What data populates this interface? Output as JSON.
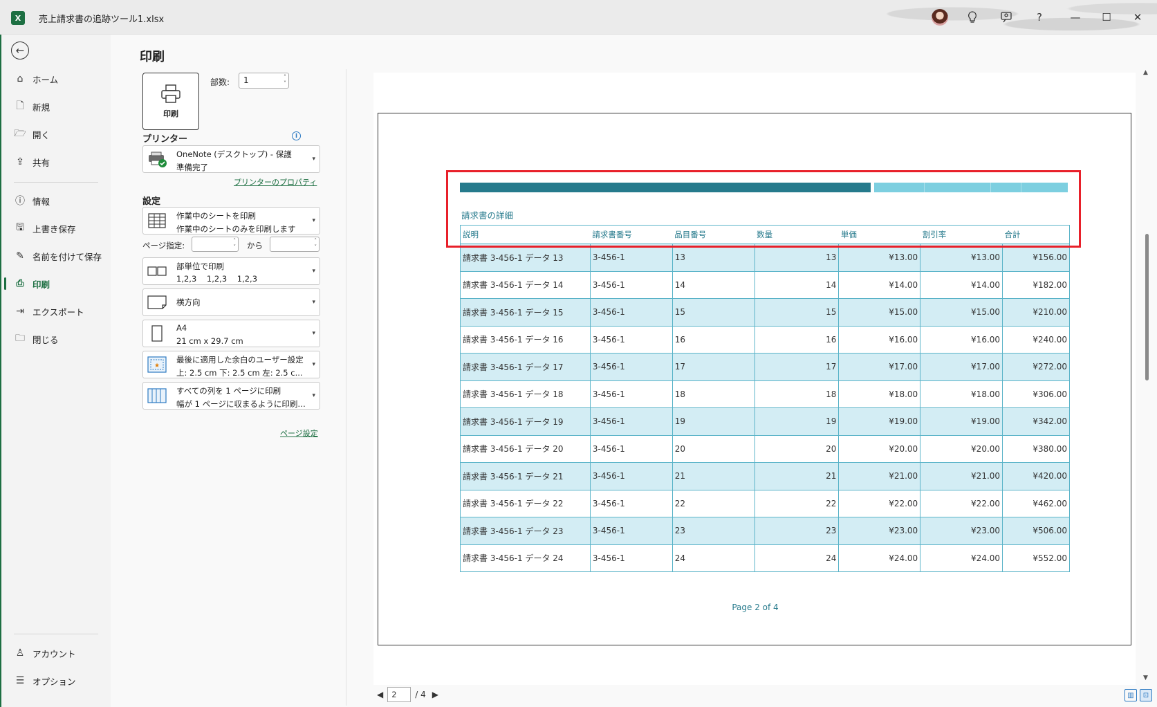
{
  "window": {
    "title": "売上請求書の追跡ツール1.xlsx",
    "app_icon_text": "X",
    "controls": [
      "avatar-icon",
      "lightbulb-icon",
      "coauthor-icon",
      "help-icon",
      "minimize-icon",
      "maximize-icon",
      "close-icon"
    ],
    "help_glyph": "?",
    "min_glyph": "—",
    "max_glyph": "☐",
    "close_glyph": "✕"
  },
  "nav": {
    "back_glyph": "←",
    "items": [
      {
        "label": "ホーム",
        "icon": "home-icon",
        "glyph": "⌂"
      },
      {
        "label": "新規",
        "icon": "new-document-icon",
        "glyph": "🗋"
      },
      {
        "label": "開く",
        "icon": "open-folder-icon",
        "glyph": "🗁"
      },
      {
        "label": "共有",
        "icon": "share-icon",
        "glyph": "⇪"
      },
      {
        "label": "情報",
        "icon": "info-icon",
        "glyph": "ⓘ"
      },
      {
        "label": "上書き保存",
        "icon": "save-icon",
        "glyph": "🖫"
      },
      {
        "label": "名前を付けて保存",
        "icon": "save-as-icon",
        "glyph": "✎"
      },
      {
        "label": "印刷",
        "icon": "print-icon",
        "glyph": "⎙"
      },
      {
        "label": "エクスポート",
        "icon": "export-icon",
        "glyph": "⇥"
      },
      {
        "label": "閉じる",
        "icon": "close-folder-icon",
        "glyph": "🗀"
      }
    ],
    "bottom_items": [
      {
        "label": "アカウント",
        "icon": "account-icon",
        "glyph": "♙"
      },
      {
        "label": "オプション",
        "icon": "options-icon",
        "glyph": "☰"
      }
    ]
  },
  "print": {
    "heading": "印刷",
    "print_button_label": "印刷",
    "copies_label": "部数:",
    "copies_value": "1",
    "printer_section": "プリンター",
    "printer_name": "OneNote (デスクトップ) - 保護",
    "printer_status": "準備完了",
    "printer_properties_link": "プリンターのプロパティ",
    "settings_section": "設定",
    "what_to_print": {
      "l1": "作業中のシートを印刷",
      "l2": "作業中のシートのみを印刷します"
    },
    "page_range_label": "ページ指定:",
    "page_range_to": "から",
    "collate": {
      "l1": "部単位で印刷",
      "l2": "1,2,3    1,2,3    1,2,3"
    },
    "orientation": "横方向",
    "paper": {
      "l1": "A4",
      "l2": "21 cm x 29.7 cm"
    },
    "margins": {
      "l1": "最後に適用した余白のユーザー設定",
      "l2": "上: 2.5 cm 下: 2.5 cm 左: 2.5 c..."
    },
    "scaling": {
      "l1": "すべての列を 1 ページに印刷",
      "l2": "幅が 1 ページに収まるように印刷イメ..."
    },
    "page_setup_link": "ページ設定"
  },
  "preview": {
    "table_title": "請求書の詳細",
    "columns": [
      "説明",
      "請求書番号",
      "品目番号",
      "数量",
      "単価",
      "割引率",
      "合計"
    ],
    "rows": [
      [
        "請求書 3-456-1 データ 13",
        "3-456-1",
        "13",
        "13",
        "¥13.00",
        "¥13.00",
        "¥156.00"
      ],
      [
        "請求書 3-456-1 データ 14",
        "3-456-1",
        "14",
        "14",
        "¥14.00",
        "¥14.00",
        "¥182.00"
      ],
      [
        "請求書 3-456-1 データ 15",
        "3-456-1",
        "15",
        "15",
        "¥15.00",
        "¥15.00",
        "¥210.00"
      ],
      [
        "請求書 3-456-1 データ 16",
        "3-456-1",
        "16",
        "16",
        "¥16.00",
        "¥16.00",
        "¥240.00"
      ],
      [
        "請求書 3-456-1 データ 17",
        "3-456-1",
        "17",
        "17",
        "¥17.00",
        "¥17.00",
        "¥272.00"
      ],
      [
        "請求書 3-456-1 データ 18",
        "3-456-1",
        "18",
        "18",
        "¥18.00",
        "¥18.00",
        "¥306.00"
      ],
      [
        "請求書 3-456-1 データ 19",
        "3-456-1",
        "19",
        "19",
        "¥19.00",
        "¥19.00",
        "¥342.00"
      ],
      [
        "請求書 3-456-1 データ 20",
        "3-456-1",
        "20",
        "20",
        "¥20.00",
        "¥20.00",
        "¥380.00"
      ],
      [
        "請求書 3-456-1 データ 21",
        "3-456-1",
        "21",
        "21",
        "¥21.00",
        "¥21.00",
        "¥420.00"
      ],
      [
        "請求書 3-456-1 データ 22",
        "3-456-1",
        "22",
        "22",
        "¥22.00",
        "¥22.00",
        "¥462.00"
      ],
      [
        "請求書 3-456-1 データ 23",
        "3-456-1",
        "23",
        "23",
        "¥23.00",
        "¥23.00",
        "¥506.00"
      ],
      [
        "請求書 3-456-1 データ 24",
        "3-456-1",
        "24",
        "24",
        "¥24.00",
        "¥24.00",
        "¥552.00"
      ]
    ],
    "footer": "Page 2 of 4",
    "current_page": "2",
    "total_pages": "/ 4",
    "colors": {
      "accent": "#267a8c",
      "light_accent": "#7dcfe0",
      "row_shade": "#d3edf4",
      "highlight": "#e8202a",
      "excel_green": "#1d6f42"
    }
  }
}
